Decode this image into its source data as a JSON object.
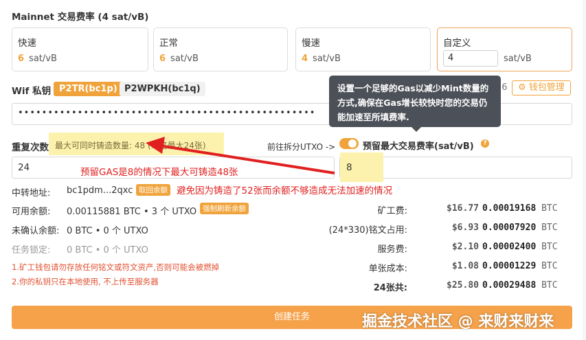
{
  "section_title": "Mainnet 交易费率 (4 sat/vB)",
  "fee_options": [
    {
      "label": "快速",
      "value": "6",
      "unit": "sat/vB"
    },
    {
      "label": "正常",
      "value": "6",
      "unit": "sat/vB"
    },
    {
      "label": "慢速",
      "value": "4",
      "unit": "sat/vB"
    },
    {
      "label": "自定义",
      "value": "4",
      "unit": "sat/vB"
    }
  ],
  "wif": {
    "label": "Wif 私钥",
    "tab_active": "P2TR(bc1p)",
    "tab_inactive": "P2WPKH(bc1q)",
    "wallet_num": "56",
    "wallet_button": "钱包管理",
    "password_mask": "••••••••••••••••••••••••••••••••••••••••••••••••••"
  },
  "tooltip": {
    "text": "设置一个足够的Gas以减少Mint数量的方式,确保在Gas增长较快时您的交易仍能加速至所填费率."
  },
  "repeat": {
    "label": "重复次数",
    "hint": "最大可同时铸造数量: 48 (每笔最大24张)",
    "value": "24",
    "split_label": "前往拆分UTXO ->",
    "reserve_label": "预留最大交易费率(sat/vB)",
    "reserve_value": "8"
  },
  "annotations": {
    "arrow_text": "预留GAS是8的情况下最大可铸造48张",
    "avoid_text": "避免因为铸造了52张而余额不够造成无法加速的情况"
  },
  "info": {
    "relay_label": "中转地址:",
    "relay_value": "bc1pdm...2qxc",
    "relay_badge": "取回余额",
    "available_label": "可用余额:",
    "available_value": "0.00115881 BTC • 3 个 UTXO",
    "available_badge": "强制刷新余额",
    "unconfirmed_label": "未确认余额:",
    "unconfirmed_value": "0 BTC • 0 个 UTXO",
    "locked_label": "任务锁定:",
    "locked_value": "0 BTC • 0 个 UTXO"
  },
  "notes": [
    "1.矿工钱包请勿存放任何铭文或符文资产,否则可能会被燃掉",
    "2.你的私钥只在本地使用, 不上传至服务器"
  ],
  "costs": [
    {
      "label": "矿工费:",
      "usd": "$16.77",
      "btc": "0.00019168",
      "unit": "BTC"
    },
    {
      "label": "(24*330)铭文占用:",
      "usd": "$6.93",
      "btc": "0.00007920",
      "unit": "BTC"
    },
    {
      "label": "服务费:",
      "usd": "$2.10",
      "btc": "0.00002400",
      "unit": "BTC"
    },
    {
      "label": "单张成本:",
      "usd": "$1.08",
      "btc": "0.00001229",
      "unit": "BTC"
    },
    {
      "label": "24张共:",
      "usd": "$25.80",
      "btc": "0.00029488",
      "unit": "BTC"
    }
  ],
  "create_button": "创建任务",
  "watermark": "掘金技术社区 @ 来财来财来",
  "colors": {
    "accent": "#f0a33a",
    "annotation_red": "#e02020",
    "highlight": "#fdf2ad"
  }
}
